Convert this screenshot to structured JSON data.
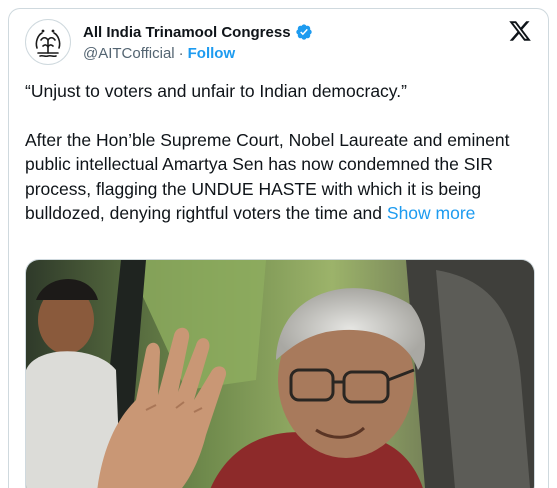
{
  "account": {
    "name": "All India Trinamool Congress",
    "handle": "@AITCofficial",
    "separator": "·",
    "follow_label": "Follow",
    "avatar_icon": "party-logo-icon",
    "verified_icon": "verified-badge-icon",
    "verified_color": "#1d9bf0"
  },
  "platform_icon": "x-logo-icon",
  "tweet": {
    "quote": "“Unjust to voters and unfair to Indian democracy.”",
    "body": "After the Hon’ble Supreme Court, Nobel Laureate and eminent public intellectual Amartya Sen has now condemned the SIR process, flagging the UNDUE HASTE with which it is being bulldozed, denying rightful voters the time and",
    "show_more_label": "Show more"
  },
  "colors": {
    "text": "#0f1419",
    "secondary": "#536471",
    "link": "#1d9bf0",
    "border": "#cfd9de"
  }
}
